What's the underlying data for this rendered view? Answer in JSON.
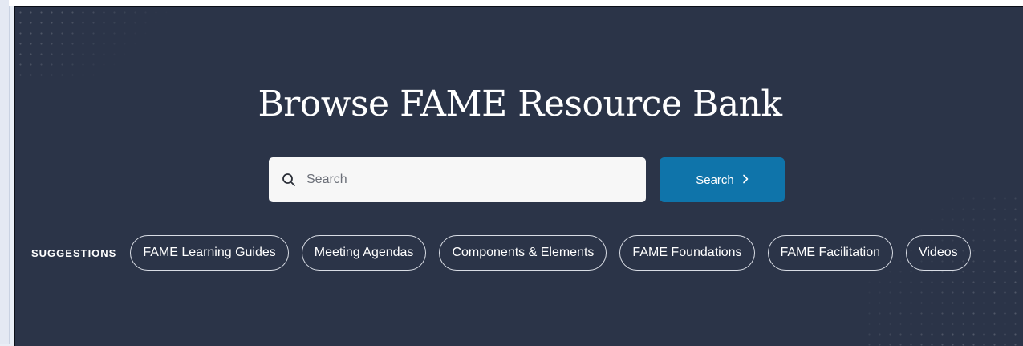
{
  "hero": {
    "title": "Browse FAME Resource Bank"
  },
  "search": {
    "placeholder": "Search",
    "button_label": "Search",
    "button_icon": "chevron-right-icon",
    "input_icon": "search-icon"
  },
  "suggestions": {
    "label": "SUGGESTIONS",
    "items": [
      {
        "label": "FAME Learning Guides"
      },
      {
        "label": "Meeting Agendas"
      },
      {
        "label": "Components & Elements"
      },
      {
        "label": "FAME Foundations"
      },
      {
        "label": "FAME Facilitation"
      },
      {
        "label": "Videos"
      }
    ]
  },
  "colors": {
    "hero_background": "#2b3448",
    "search_button": "#0f74aa",
    "text": "#ffffff"
  }
}
